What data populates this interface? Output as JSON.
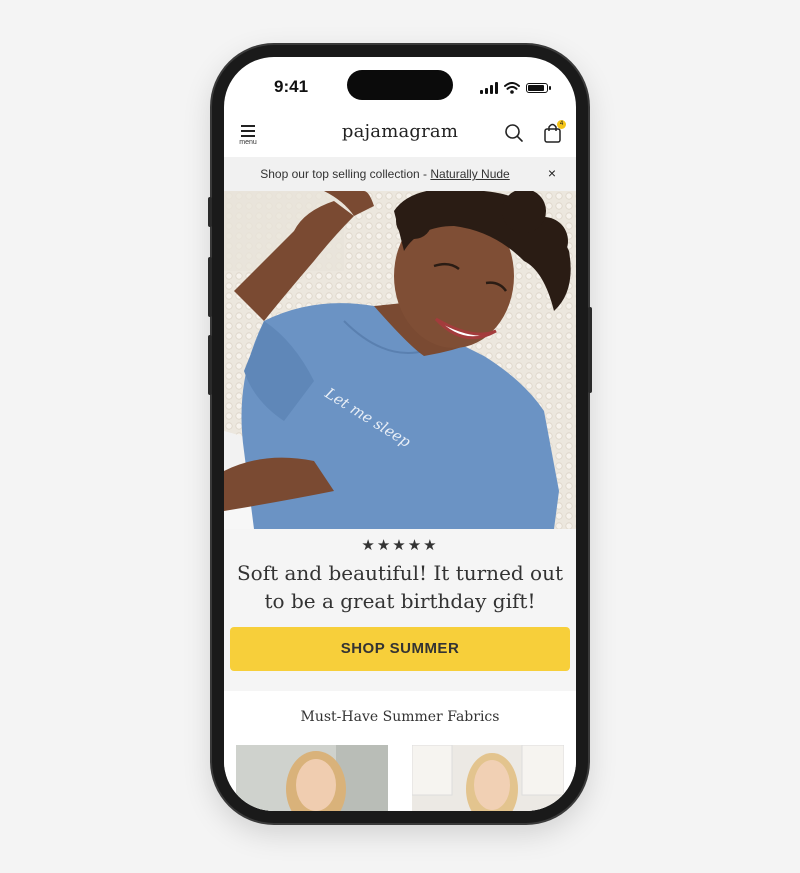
{
  "status": {
    "time": "9:41"
  },
  "header": {
    "menu_label": "menu",
    "logo": "pajamagram",
    "cart_count": "4"
  },
  "banner": {
    "text": "Shop our top selling collection - ",
    "link": "Naturally Nude",
    "close": "×"
  },
  "hero": {
    "shirt_text": "Let me sleep"
  },
  "review": {
    "stars": "★★★★★",
    "quote": "Soft and beautiful! It turned out to be a great birthday gift!"
  },
  "cta": {
    "label": "SHOP SUMMER"
  },
  "fabrics": {
    "title": "Must-Have Summer Fabrics"
  },
  "colors": {
    "accent": "#f7cf3a",
    "shirt": "#6b93c4",
    "banner_bg": "#f1f1f1"
  }
}
